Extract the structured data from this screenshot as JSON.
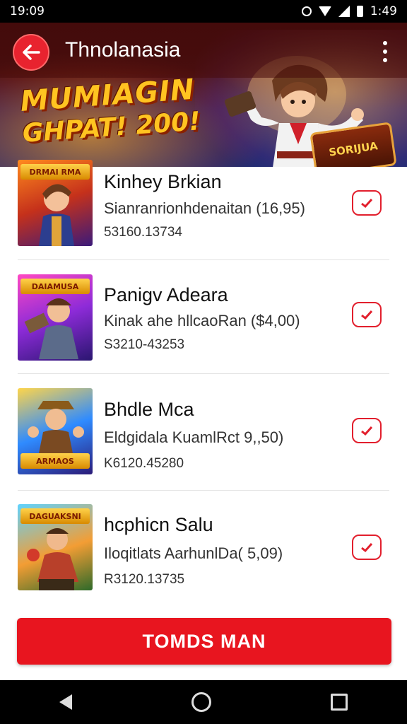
{
  "status_bar": {
    "time_left": "19:09",
    "time_right": "1:49"
  },
  "header": {
    "title": "Thnolanasia",
    "back_icon": "arrow-left-icon",
    "menu_icon": "more-vert-icon",
    "accent": "#e8232f"
  },
  "banner": {
    "line1": "MUMIAGIN",
    "line2": "GHPAT! 200!",
    "badge": "SORIJUA"
  },
  "items": [
    {
      "title": "Kinhey Brkian",
      "subtitle": "Sianranrionhdenaitan (16,95)",
      "code": "53160.13734",
      "thumb_label": "DRMAI RMA",
      "thumb_colors": [
        "#ff8a1e",
        "#c5311b",
        "#3b1a7a"
      ]
    },
    {
      "title": "Panigv Adeara",
      "subtitle": "Kinak ahe hllcaoRan ($4,00)",
      "code": "S3210-43253",
      "thumb_label": "DAIAMUSA",
      "thumb_colors": [
        "#ff49c3",
        "#8d2bd8",
        "#2a1670"
      ]
    },
    {
      "title": "Bhdle Mca",
      "subtitle": "Eldgidala KuamlRct 9,,50)",
      "code": "K6120.45280",
      "thumb_label": "ARMAOS",
      "thumb_colors": [
        "#ffd54a",
        "#2f8bff",
        "#2b1b78"
      ]
    },
    {
      "title": "hcphicn Salu",
      "subtitle": "Iloqitlats AarhunlDa( 5,09)",
      "code": "R3120.13735",
      "thumb_label": "DAGUAKSNI",
      "thumb_colors": [
        "#5fd3ff",
        "#f39d34",
        "#2e6a2a"
      ]
    }
  ],
  "cta": {
    "label": "TOMDS MAN",
    "color": "#e8151f"
  },
  "nav": {
    "back_icon": "nav-back-icon",
    "home_icon": "nav-home-icon",
    "recent_icon": "nav-recents-icon"
  }
}
